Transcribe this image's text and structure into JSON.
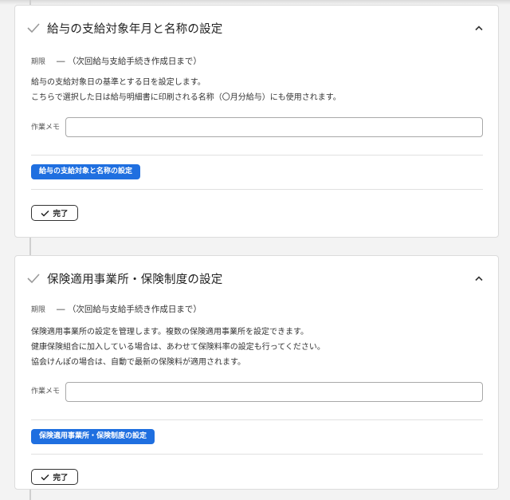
{
  "sections": [
    {
      "title": "給与の支給対象年月と名称の設定",
      "deadline_label": "期限",
      "deadline_value": "― （次回給与支給手続き作成日まで）",
      "description": [
        "給与の支給対象日の基準とする日を設定します。",
        "こちらで選択した日は給与明細書に印刷される名称（〇月分給与）にも使用されます。"
      ],
      "memo_label": "作業メモ",
      "memo_value": "",
      "action_label": "給与の支給対象と名称の設定",
      "done_label": "完了"
    },
    {
      "title": "保険適用事業所・保険制度の設定",
      "deadline_label": "期限",
      "deadline_value": "― （次回給与支給手続き作成日まで）",
      "description": [
        "保険適用事業所の設定を管理します。複数の保険適用事業所を設定できます。",
        "健康保険組合に加入している場合は、あわせて保険料率の設定も行ってください。",
        "協会けんぽの場合は、自動で最新の保険料が適用されます。"
      ],
      "memo_label": "作業メモ",
      "memo_value": "",
      "action_label": "保険適用事業所・保険制度の設定",
      "done_label": "完了"
    }
  ],
  "icons": {
    "section_status": "check-icon",
    "collapse": "chevron-up-icon",
    "done": "check-icon"
  },
  "colors": {
    "accent": "#1f6fe0",
    "check_gray": "#9a9a9a",
    "page_bg": "#f3f3f3"
  }
}
